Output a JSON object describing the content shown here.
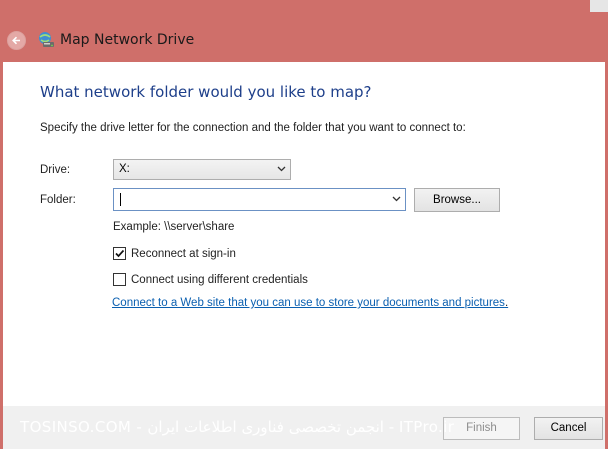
{
  "window": {
    "title": "Map Network Drive",
    "accent_color": "#cf6f6a"
  },
  "icons": {
    "back": "back-arrow-icon",
    "title": "network-drive-icon",
    "dropdown": "chevron-down-icon",
    "check": "checkmark-icon"
  },
  "main": {
    "heading": "What network folder would you like to map?",
    "instructions": "Specify the drive letter for the connection and the folder that you want to connect to:",
    "drive": {
      "label": "Drive:",
      "value": "X:"
    },
    "folder": {
      "label": "Folder:",
      "value": "",
      "browse_label": "Browse..."
    },
    "example": "Example: \\\\server\\share",
    "reconnect": {
      "label": "Reconnect at sign-in",
      "checked": true
    },
    "credentials": {
      "label": "Connect using different credentials",
      "checked": false
    },
    "web_link": "Connect to a Web site that you can use to store your documents and pictures",
    "web_link_suffix": "."
  },
  "footer": {
    "watermark": "TOSINSO.COM - انجمن تخصصی فناوری اطلاعات ایران - ITPro.ir",
    "finish_label": "Finish",
    "cancel_label": "Cancel"
  }
}
